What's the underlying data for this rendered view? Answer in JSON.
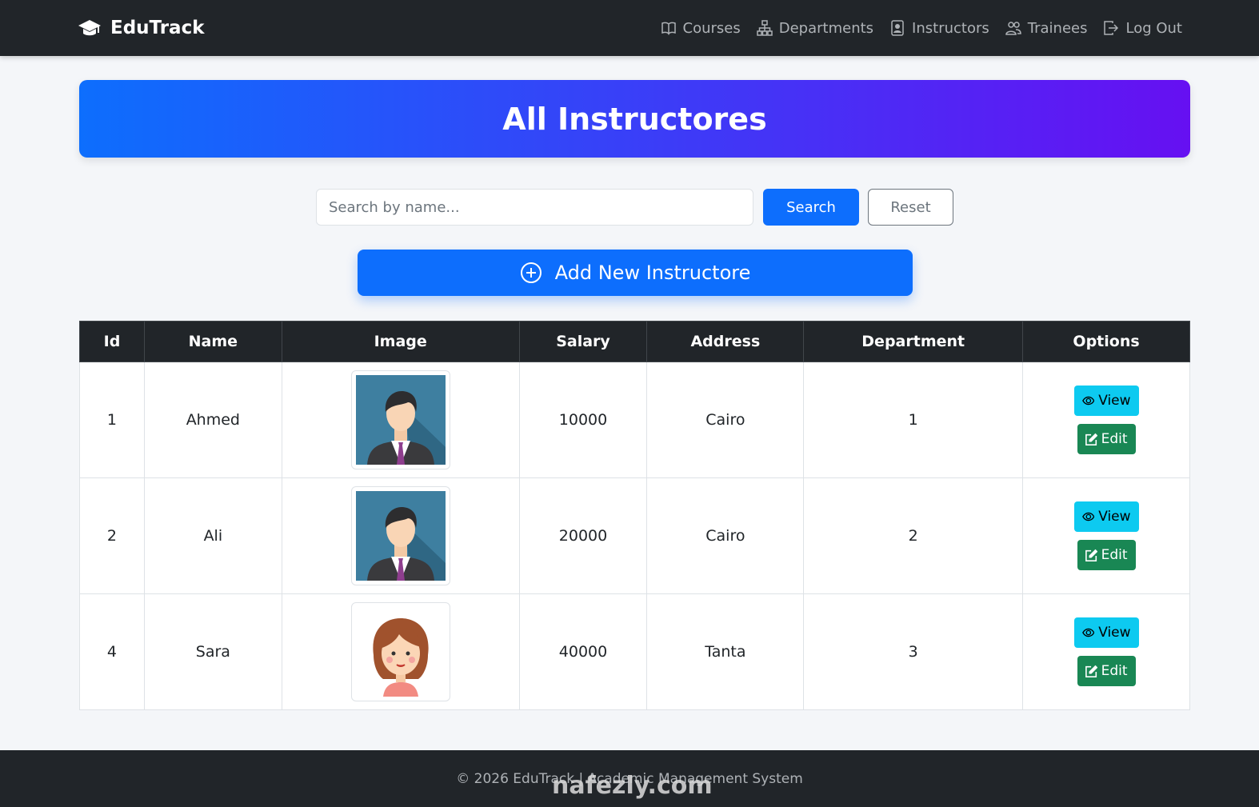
{
  "nav": {
    "brand": "EduTrack",
    "links": [
      {
        "label": "Courses",
        "icon": "book-icon"
      },
      {
        "label": "Departments",
        "icon": "diagram-icon"
      },
      {
        "label": "Instructors",
        "icon": "person-badge-icon"
      },
      {
        "label": "Trainees",
        "icon": "people-icon"
      },
      {
        "label": "Log Out",
        "icon": "logout-icon"
      }
    ]
  },
  "banner": {
    "title": "All Instructores"
  },
  "search": {
    "placeholder": "Search by name...",
    "value": "",
    "search_label": "Search",
    "reset_label": "Reset"
  },
  "add_label": "Add New Instructore",
  "table": {
    "headers": [
      "Id",
      "Name",
      "Image",
      "Salary",
      "Address",
      "Department",
      "Options"
    ],
    "rows": [
      {
        "id": "1",
        "name": "Ahmed",
        "image": "male-avatar",
        "salary": "10000",
        "address": "Cairo",
        "department": "1"
      },
      {
        "id": "2",
        "name": "Ali",
        "image": "male-avatar",
        "salary": "20000",
        "address": "Cairo",
        "department": "2"
      },
      {
        "id": "4",
        "name": "Sara",
        "image": "female-avatar",
        "salary": "40000",
        "address": "Tanta",
        "department": "3"
      }
    ],
    "view_label": "View",
    "edit_label": "Edit"
  },
  "footer": {
    "text": "© 2026 EduTrack | Academic Management System"
  },
  "watermark": "nafezly.com",
  "colors": {
    "primary": "#0d6efd",
    "gradient_end": "#6610f2",
    "info": "#0dcaf0",
    "success": "#198754",
    "dark": "#212529"
  }
}
